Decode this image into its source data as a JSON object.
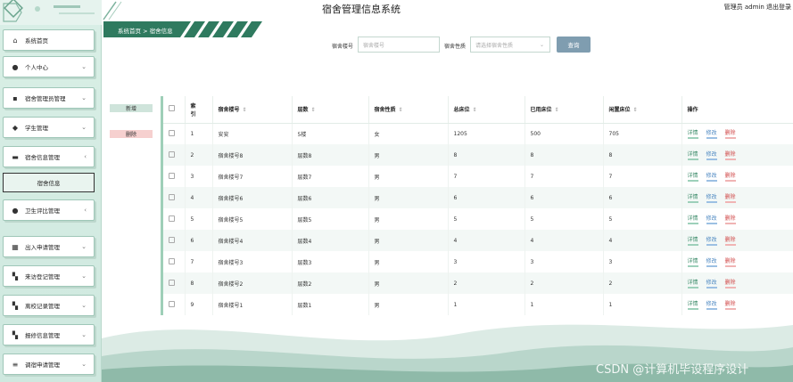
{
  "header": {
    "title": "宿舍管理信息系统",
    "user_info": "管理员 admin  退出登录"
  },
  "breadcrumb": "系统首页  >  宿舍信息",
  "sidebar": {
    "items": [
      {
        "label": "系统首页",
        "icon": "home-icon",
        "chevron": ""
      },
      {
        "label": "个人中心",
        "icon": "user-icon",
        "chevron": "⌄"
      },
      {
        "label": "宿舍管理员管理",
        "icon": "admin-icon",
        "chevron": "⌄"
      },
      {
        "label": "学生管理",
        "icon": "student-icon",
        "chevron": "⌄"
      },
      {
        "label": "宿舍信息管理",
        "icon": "dorm-icon",
        "chevron": "‹"
      },
      {
        "label": "卫生评比管理",
        "icon": "user-icon",
        "chevron": "‹"
      },
      {
        "label": "出入申请管理",
        "icon": "calendar-icon",
        "chevron": "⌄"
      },
      {
        "label": "来访登记管理",
        "icon": "grid-icon",
        "chevron": "⌄"
      },
      {
        "label": "离校记录管理",
        "icon": "grid-icon",
        "chevron": "⌄"
      },
      {
        "label": "报修信息管理",
        "icon": "grid-icon",
        "chevron": "⌄"
      },
      {
        "label": "调宿申请管理",
        "icon": "sliders-icon",
        "chevron": "⌄"
      }
    ],
    "sub_item": "宿舍信息"
  },
  "search": {
    "label1": "宿舍楼号",
    "placeholder1": "宿舍楼号",
    "label2": "宿舍性质",
    "placeholder2": "请选择宿舍性质",
    "button": "查询"
  },
  "actions": {
    "add": "新增",
    "delete": "删除"
  },
  "table": {
    "headers": [
      "索引",
      "宿舍楼号",
      "层数",
      "宿舍性质",
      "总床位",
      "已用床位",
      "闲置床位",
      "操作"
    ],
    "index_header": "索\n引",
    "rows": [
      [
        "1",
        "安安",
        "5楼",
        "女",
        "1205",
        "500",
        "705"
      ],
      [
        "2",
        "宿舍楼号8",
        "层数8",
        "男",
        "8",
        "8",
        "8"
      ],
      [
        "3",
        "宿舍楼号7",
        "层数7",
        "男",
        "7",
        "7",
        "7"
      ],
      [
        "4",
        "宿舍楼号6",
        "层数6",
        "男",
        "6",
        "6",
        "6"
      ],
      [
        "5",
        "宿舍楼号5",
        "层数5",
        "男",
        "5",
        "5",
        "5"
      ],
      [
        "6",
        "宿舍楼号4",
        "层数4",
        "男",
        "4",
        "4",
        "4"
      ],
      [
        "7",
        "宿舍楼号3",
        "层数3",
        "男",
        "3",
        "3",
        "3"
      ],
      [
        "8",
        "宿舍楼号2",
        "层数2",
        "男",
        "2",
        "2",
        "2"
      ],
      [
        "9",
        "宿舍楼号1",
        "层数1",
        "男",
        "1",
        "1",
        "1"
      ]
    ],
    "ops": {
      "view": "详情",
      "edit": "修改",
      "del": "删除"
    }
  },
  "watermark": "CSDN @计算机毕设程序设计"
}
